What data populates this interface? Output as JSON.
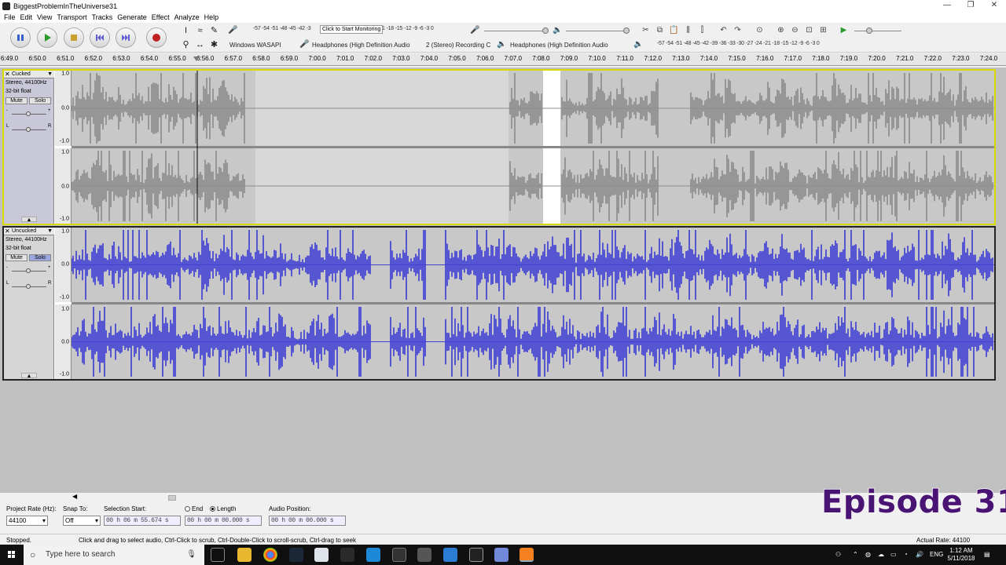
{
  "window": {
    "title": "BiggestProblemInTheUniverse31",
    "controls": [
      "—",
      "❐",
      "✕"
    ]
  },
  "menu": [
    "File",
    "Edit",
    "View",
    "Transport",
    "Tracks",
    "Generate",
    "Effect",
    "Analyze",
    "Help"
  ],
  "transport": {
    "buttons": [
      "pause-button",
      "play-button",
      "stop-button",
      "skip-start-button",
      "skip-end-button",
      "record-button"
    ]
  },
  "meters": {
    "record_scale": "-57 -54 -51 -48 -45 -42 -3",
    "monitor_prompt": "Click to Start Monitoring",
    "record_scale_tail": "1 -18 -15 -12 -9 -6 -3 0",
    "playback_scale": "-57 -54 -51 -48 -45 -42 -39 -36 -33 -30 -27 -24 -21 -18 -15 -12 -9 -6 -3 0"
  },
  "devices": {
    "host": "Windows WASAPI",
    "recording_device": "Headphones (High Definition Audio",
    "channels": "2 (Stereo) Recording C",
    "playback_device": "Headphones (High Definition Audio"
  },
  "ruler": {
    "labels": [
      "6:49.0",
      "6:50.0",
      "6:51.0",
      "6:52.0",
      "6:53.0",
      "6:54.0",
      "6:55.0",
      "6:56.0",
      "6:57.0",
      "6:58.0",
      "6:59.0",
      "7:00.0",
      "7:01.0",
      "7:02.0",
      "7:03.0",
      "7:04.0",
      "7:05.0",
      "7:06.0",
      "7:07.0",
      "7:08.0",
      "7:09.0",
      "7:10.0",
      "7:11.0",
      "7:12.0",
      "7:13.0",
      "7:14.0",
      "7:15.0",
      "7:16.0",
      "7:17.0",
      "7:18.0",
      "7:19.0",
      "7:20.0",
      "7:21.0",
      "7:22.0",
      "7:23.0",
      "7:24.0"
    ]
  },
  "tracks": [
    {
      "name": "Cucked",
      "info1": "Stereo, 44100Hz",
      "info2": "32-bit float",
      "mute": "Mute",
      "solo": "Solo",
      "wave_color": "#8a8a8a",
      "scale": [
        "1.0",
        "0.0",
        "-1.0",
        "1.0",
        "0.0",
        "-1.0"
      ]
    },
    {
      "name": "Uncucked",
      "info1": "Stereo, 44100Hz",
      "info2": "32-bit float",
      "mute": "Mute",
      "solo": "Solo",
      "wave_color": "#3a3ad4",
      "scale": [
        "1.0",
        "0.0",
        "-1.0",
        "1.0",
        "0.0",
        "-1.0"
      ]
    }
  ],
  "selection_toolbar": {
    "project_rate_label": "Project Rate (Hz):",
    "project_rate": "44100",
    "snap_label": "Snap To:",
    "snap_value": "Off",
    "sel_start_label": "Selection Start:",
    "sel_start_value": "00 h 06 m 55.674 s",
    "end_label": "End",
    "length_label": "Length",
    "length_value": "00 h 00 m 00.000 s",
    "audio_pos_label": "Audio Position:",
    "audio_pos_value": "00 h 00 m 00.000 s"
  },
  "overlay": {
    "episode": "Episode 31"
  },
  "status": {
    "state": "Stopped.",
    "hint": "Click and drag to select audio, Ctrl-Click to scrub, Ctrl-Double-Click to scroll-scrub, Ctrl-drag to seek",
    "rate": "Actual Rate: 44100"
  },
  "taskbar": {
    "search_placeholder": "Type here to search",
    "language": "ENG",
    "time": "1:12 AM",
    "date": "5/11/2018"
  }
}
